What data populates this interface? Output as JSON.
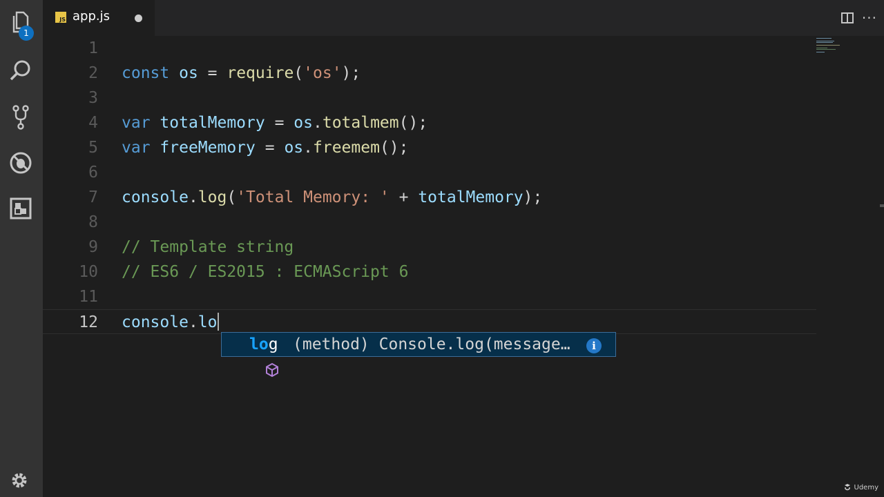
{
  "activity_bar": {
    "explorer_badge": "1",
    "icons": [
      "files-icon",
      "search-icon",
      "source-control-icon",
      "debug-icon",
      "extensions-icon"
    ]
  },
  "tab": {
    "name": "app.js",
    "file_type": "JS"
  },
  "editor": {
    "lines": [
      {
        "n": "1",
        "tokens": []
      },
      {
        "n": "2",
        "tokens": [
          {
            "t": "const",
            "c": "kw"
          },
          {
            "t": " ",
            "c": "pl"
          },
          {
            "t": "os",
            "c": "var"
          },
          {
            "t": " = ",
            "c": "pl"
          },
          {
            "t": "require",
            "c": "fn"
          },
          {
            "t": "(",
            "c": "pl"
          },
          {
            "t": "'os'",
            "c": "str"
          },
          {
            "t": ");",
            "c": "pl"
          }
        ]
      },
      {
        "n": "3",
        "tokens": []
      },
      {
        "n": "4",
        "tokens": [
          {
            "t": "var",
            "c": "kw"
          },
          {
            "t": " ",
            "c": "pl"
          },
          {
            "t": "totalMemory",
            "c": "var"
          },
          {
            "t": " = ",
            "c": "pl"
          },
          {
            "t": "os",
            "c": "var"
          },
          {
            "t": ".",
            "c": "pl"
          },
          {
            "t": "totalmem",
            "c": "fn"
          },
          {
            "t": "();",
            "c": "pl"
          }
        ]
      },
      {
        "n": "5",
        "tokens": [
          {
            "t": "var",
            "c": "kw"
          },
          {
            "t": " ",
            "c": "pl"
          },
          {
            "t": "freeMemory",
            "c": "var"
          },
          {
            "t": " = ",
            "c": "pl"
          },
          {
            "t": "os",
            "c": "var"
          },
          {
            "t": ".",
            "c": "pl"
          },
          {
            "t": "freemem",
            "c": "fn"
          },
          {
            "t": "();",
            "c": "pl"
          }
        ]
      },
      {
        "n": "6",
        "tokens": []
      },
      {
        "n": "7",
        "tokens": [
          {
            "t": "console",
            "c": "var"
          },
          {
            "t": ".",
            "c": "pl"
          },
          {
            "t": "log",
            "c": "fn"
          },
          {
            "t": "(",
            "c": "pl"
          },
          {
            "t": "'Total Memory: '",
            "c": "str"
          },
          {
            "t": " + ",
            "c": "pl"
          },
          {
            "t": "totalMemory",
            "c": "var"
          },
          {
            "t": ");",
            "c": "pl"
          }
        ]
      },
      {
        "n": "8",
        "tokens": []
      },
      {
        "n": "9",
        "tokens": [
          {
            "t": "// Template string",
            "c": "cmt"
          }
        ]
      },
      {
        "n": "10",
        "tokens": [
          {
            "t": "// ES6 / ES2015 : ECMAScript 6",
            "c": "cmt"
          }
        ]
      },
      {
        "n": "11",
        "tokens": []
      },
      {
        "n": "12",
        "current": true,
        "tokens": [
          {
            "t": "console",
            "c": "var"
          },
          {
            "t": ".",
            "c": "pl"
          },
          {
            "t": "lo",
            "c": "var"
          }
        ]
      }
    ]
  },
  "suggest": {
    "match": "lo",
    "rest": "g",
    "detail": "(method) Console.log(message…",
    "info": "i"
  },
  "watermark": "Udemy"
}
